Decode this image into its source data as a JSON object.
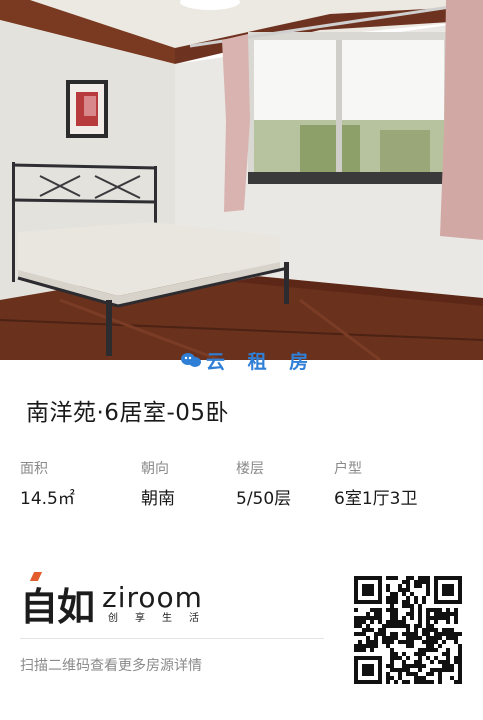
{
  "watermark": {
    "icon": "cloud-chat-icon",
    "text": "云 租 房"
  },
  "listing": {
    "title": "南洋苑·6居室-05卧"
  },
  "specs": {
    "area": {
      "label": "面积",
      "value": "14.5㎡"
    },
    "orientation": {
      "label": "朝向",
      "value": "朝南"
    },
    "floor": {
      "label": "楼层",
      "value": "5/50层"
    },
    "layout": {
      "label": "户型",
      "value": "6室1厅3卫"
    }
  },
  "brand": {
    "name_zh": "自如",
    "name_en": "ziroom",
    "slogan": "创享生活",
    "accent_color": "#e25c2d"
  },
  "footer": {
    "qr_hint": "扫描二维码查看更多房源详情"
  },
  "colors": {
    "watermark": "#2f7fd6",
    "label": "#8a8a8a",
    "text": "#1a1a1a"
  }
}
